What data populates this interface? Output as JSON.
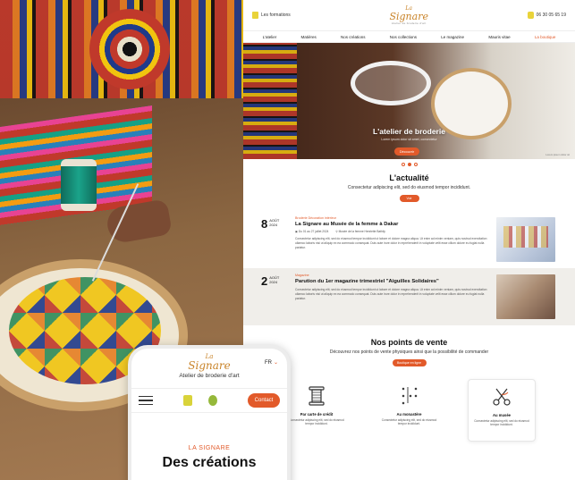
{
  "brand": {
    "logo_la": "La",
    "logo_name": "Signare",
    "logo_tagline": "Atelier de broderie d'art"
  },
  "desktop": {
    "header": {
      "formations": "Les formations",
      "phone": "06 30 05 65 19"
    },
    "nav": [
      "L'atelier",
      "Matières",
      "Nos créations",
      "Nos collections",
      "Le magazine",
      "Mauris vitae",
      "La boutique"
    ],
    "hero": {
      "title": "L'atelier de broderie",
      "subtitle": "Lorem ipsum dolor sit amet, consectetur",
      "button": "Découvrir",
      "caption": "Lorem ipsum dolor sit"
    },
    "news": {
      "title": "L'actualité",
      "subtitle": "Consectetur adipiscing elit, sed do eiusmod tempor incididunt.",
      "button": "Voir",
      "items": [
        {
          "day": "8",
          "month": "Août",
          "year": "2024",
          "category": "Broderie Décoration intérieur",
          "title": "La Signare au Musée de la femme à Dakar",
          "date_range": "Du 01 au 27 juillet 2024",
          "location": "Musée de la femme Henriette Bathily",
          "text": "Consectetur adipiscing elit, sed do eiusmod tempor incididunt ut labore et dolore magna aliqua. Ut enim ad minim veniam, quis nostrud exercitation ullamco laboris nisi ut aliquip ex ea commodo consequat. Duis aute irure dolor in reprehenderit in voluptate velit esse cillum dolore eu fugiat nulla pariatur."
        },
        {
          "day": "2",
          "month": "Août",
          "year": "2024",
          "category": "Magazine",
          "title": "Parution du 1er magazine trimestriel \"Aiguilles Solidaires\"",
          "text": "Consectetur adipiscing elit, sed do eiusmod tempor incididunt ut labore et dolore magna aliqua. Ut enim ad minim veniam, quis nostrud exercitation ullamco laboris nisi ut aliquip ex ea commodo consequat. Duis aute irure dolor in reprehenderit in voluptate velit esse cillum dolore eu fugiat nulla pariatur."
        }
      ]
    },
    "points": {
      "title": "Nos points de vente",
      "subtitle": "Découvrez nos points de vente physiques ainsi que la possibilité de commander",
      "button": "Boutique en ligne",
      "cards": [
        {
          "name": "Par carte de crédit",
          "text": "Consectetur adipiscing elit, sed do eiusmod tempor incididunt."
        },
        {
          "name": "Au monastère",
          "text": "Consectetur adipiscing elit, sed do eiusmod tempor incididunt."
        },
        {
          "name": "Au musée",
          "text": "Consectetur adipiscing elit, sed do eiusmod tempor incididunt."
        }
      ]
    }
  },
  "mobile": {
    "lang": "FR",
    "subtitle": "Atelier de broderie d'art",
    "contact": "Contact",
    "kicker": "LA SIGNARE",
    "headline": "Des créations"
  },
  "colors": {
    "accent": "#e25a2a",
    "logo_gold": "#c9842a",
    "icon_yellow": "#e9d33a"
  }
}
